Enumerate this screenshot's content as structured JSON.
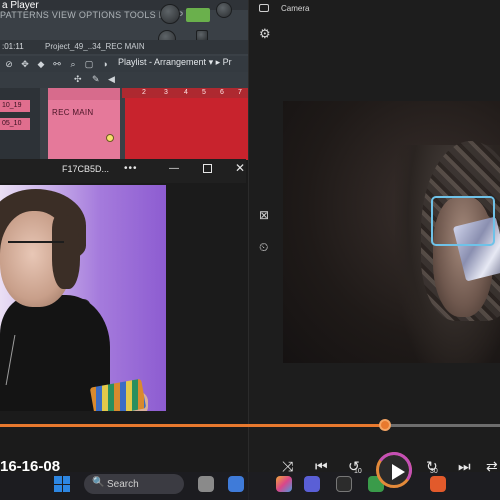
{
  "fl_studio": {
    "app_title": "a Player",
    "menu": "PATTERNS VIEW OPTIONS TOOLS HELP",
    "status_badge": "",
    "time": ":01:11",
    "project_name": "Project_49_..34_REC MAIN",
    "playlist_title": "Playlist - Arrangement",
    "playlist_arrow": "▸ Pr",
    "pattern_label": "REC MAIN",
    "left_tags": [
      "10_19",
      "05_10"
    ],
    "ruler_marks": [
      "2",
      "3",
      "4",
      "5",
      "6",
      "7"
    ]
  },
  "camera": {
    "title": "Camera",
    "settings_icon": "gear-icon",
    "side_icons": [
      "no-camera-icon",
      "timer-icon"
    ]
  },
  "media_player": {
    "title": "F17CB5D...",
    "more_label": "•••",
    "minimize_label": "—",
    "close_label": "✕",
    "time_label": "16-16-08",
    "progress": 0.77,
    "colors": {
      "accent": "#e8792e",
      "ring": "#c54fb6"
    },
    "controls": {
      "shuffle": "⤨",
      "prev": "⏮",
      "rewind": "↺",
      "rewind_seconds": "10",
      "forward": "↻",
      "forward_seconds": "30",
      "next": "⏭",
      "repeat": "⇄"
    }
  },
  "taskbar": {
    "search_placeholder": "Search",
    "search_icon": "🔍"
  }
}
